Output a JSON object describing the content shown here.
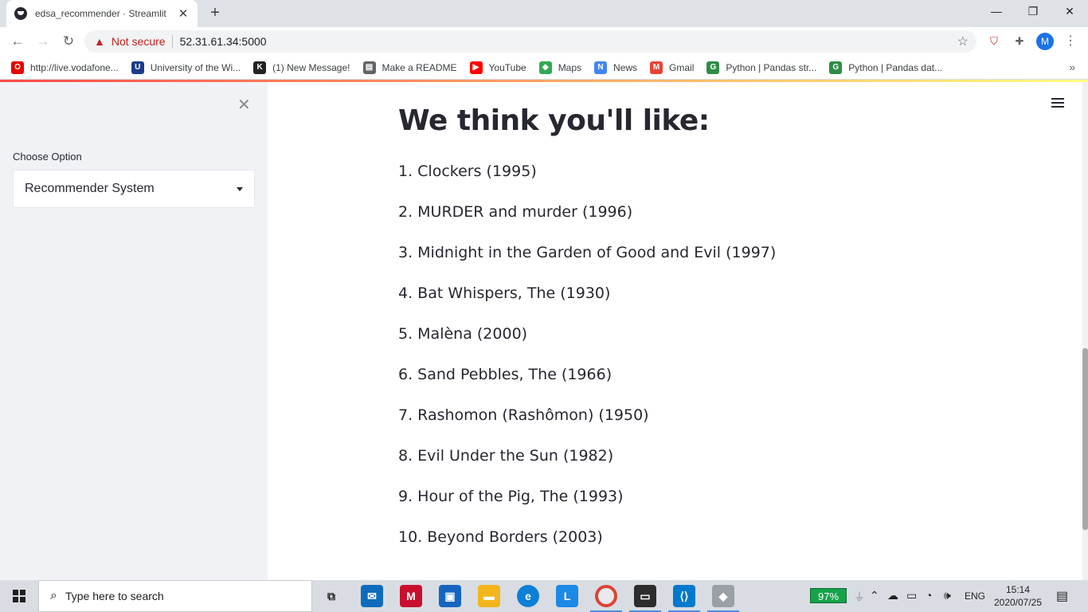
{
  "browser": {
    "tab_title": "edsa_recommender · Streamlit",
    "new_tab_symbol": "+",
    "security_label": "Not secure",
    "url": "52.31.61.34:5000",
    "profile_initial": "M"
  },
  "bookmarks": [
    {
      "label": "http://live.vodafone...",
      "icon": "vodafone-icon",
      "color": "#e60000"
    },
    {
      "label": "University of the Wi...",
      "icon": "university-icon",
      "color": "#1b3c8c"
    },
    {
      "label": "(1) New Message!",
      "icon": "k-icon",
      "color": "#222222"
    },
    {
      "label": "Make a README",
      "icon": "document-icon",
      "color": "#5f6368"
    },
    {
      "label": "YouTube",
      "icon": "youtube-icon",
      "color": "#ff0000"
    },
    {
      "label": "Maps",
      "icon": "maps-icon",
      "color": "#34a853"
    },
    {
      "label": "News",
      "icon": "news-icon",
      "color": "#4285f4"
    },
    {
      "label": "Gmail",
      "icon": "gmail-icon",
      "color": "#ea4335"
    },
    {
      "label": "Python | Pandas str...",
      "icon": "geeksforgeeks-icon",
      "color": "#2f8d46"
    },
    {
      "label": "Python | Pandas dat...",
      "icon": "geeksforgeeks-icon",
      "color": "#2f8d46"
    }
  ],
  "sidebar": {
    "label": "Choose Option",
    "selected_option": "Recommender System"
  },
  "main": {
    "heading": "We think you'll like:",
    "recommendations": [
      "1. Clockers (1995)",
      "2. MURDER and murder (1996)",
      "3. Midnight in the Garden of Good and Evil (1997)",
      "4. Bat Whispers, The (1930)",
      "5. Malèna (2000)",
      "6. Sand Pebbles, The (1966)",
      "7. Rashomon (Rashômon) (1950)",
      "8. Evil Under the Sun (1982)",
      "9. Hour of the Pig, The (1993)",
      "10. Beyond Borders (2003)"
    ]
  },
  "taskbar": {
    "search_placeholder": "Type here to search",
    "battery": "97%",
    "language": "ENG",
    "time": "15:14",
    "date": "2020/07/25"
  },
  "colors": {
    "accent": "#ff4b4b",
    "sidebar_bg": "#f0f2f6",
    "text": "#262730"
  }
}
